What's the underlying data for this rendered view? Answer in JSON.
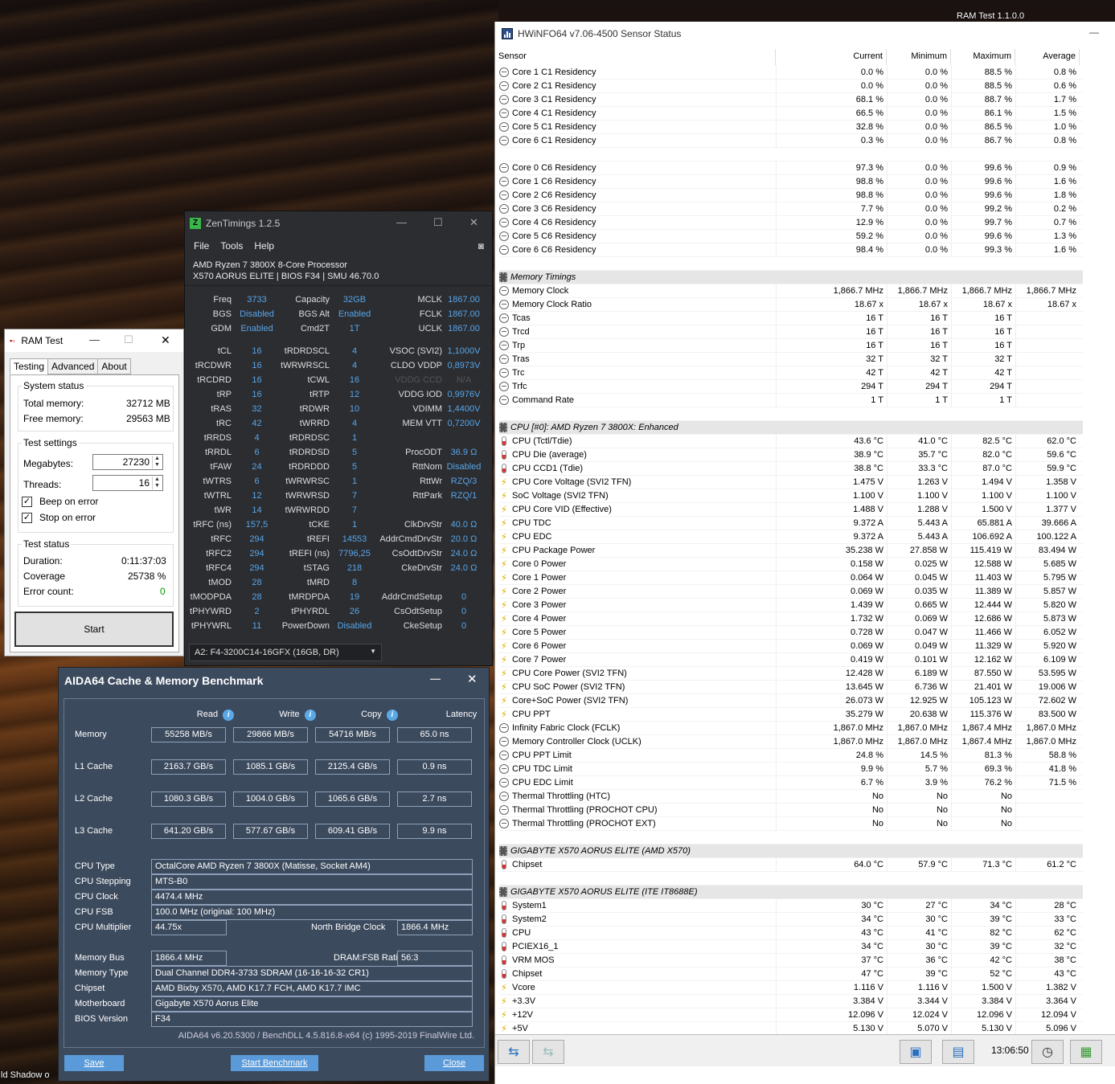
{
  "desktop": {
    "corner_label": "RAM Test 1.1.0.0",
    "bottom_text": "ld  Shadow o"
  },
  "hwinfo": {
    "title": "HWiNFO64 v7.06-4500 Sensor Status",
    "columns": [
      "Sensor",
      "Current",
      "Minimum",
      "Maximum",
      "Average"
    ],
    "time": "13:06:50",
    "rows": [
      {
        "t": "row",
        "i": "clk",
        "n": "Core 1 C1 Residency",
        "c": "0.0 %",
        "mn": "0.0 %",
        "mx": "88.5 %",
        "a": "0.8 %"
      },
      {
        "t": "row",
        "i": "clk",
        "n": "Core 2 C1 Residency",
        "c": "0.0 %",
        "mn": "0.0 %",
        "mx": "88.5 %",
        "a": "0.6 %"
      },
      {
        "t": "row",
        "i": "clk",
        "n": "Core 3 C1 Residency",
        "c": "68.1 %",
        "mn": "0.0 %",
        "mx": "88.7 %",
        "a": "1.7 %"
      },
      {
        "t": "row",
        "i": "clk",
        "n": "Core 4 C1 Residency",
        "c": "66.5 %",
        "mn": "0.0 %",
        "mx": "86.1 %",
        "a": "1.5 %"
      },
      {
        "t": "row",
        "i": "clk",
        "n": "Core 5 C1 Residency",
        "c": "32.8 %",
        "mn": "0.0 %",
        "mx": "86.5 %",
        "a": "1.0 %"
      },
      {
        "t": "row",
        "i": "clk",
        "n": "Core 6 C1 Residency",
        "c": "0.3 %",
        "mn": "0.0 %",
        "mx": "86.7 %",
        "a": "0.8 %"
      },
      {
        "t": "blank"
      },
      {
        "t": "row",
        "i": "clk",
        "n": "Core 0 C6 Residency",
        "c": "97.3 %",
        "mn": "0.0 %",
        "mx": "99.6 %",
        "a": "0.9 %"
      },
      {
        "t": "row",
        "i": "clk",
        "n": "Core 1 C6 Residency",
        "c": "98.8 %",
        "mn": "0.0 %",
        "mx": "99.6 %",
        "a": "1.6 %"
      },
      {
        "t": "row",
        "i": "clk",
        "n": "Core 2 C6 Residency",
        "c": "98.8 %",
        "mn": "0.0 %",
        "mx": "99.6 %",
        "a": "1.8 %"
      },
      {
        "t": "row",
        "i": "clk",
        "n": "Core 3 C6 Residency",
        "c": "7.7 %",
        "mn": "0.0 %",
        "mx": "99.2 %",
        "a": "0.2 %"
      },
      {
        "t": "row",
        "i": "clk",
        "n": "Core 4 C6 Residency",
        "c": "12.9 %",
        "mn": "0.0 %",
        "mx": "99.7 %",
        "a": "0.7 %"
      },
      {
        "t": "row",
        "i": "clk",
        "n": "Core 5 C6 Residency",
        "c": "59.2 %",
        "mn": "0.0 %",
        "mx": "99.6 %",
        "a": "1.3 %"
      },
      {
        "t": "row",
        "i": "clk",
        "n": "Core 6 C6 Residency",
        "c": "98.4 %",
        "mn": "0.0 %",
        "mx": "99.3 %",
        "a": "1.6 %"
      },
      {
        "t": "blank"
      },
      {
        "t": "sec",
        "n": "Memory Timings"
      },
      {
        "t": "row",
        "i": "clk",
        "n": "Memory Clock",
        "c": "1,866.7 MHz",
        "mn": "1,866.7 MHz",
        "mx": "1,866.7 MHz",
        "a": "1,866.7 MHz"
      },
      {
        "t": "row",
        "i": "clk",
        "n": "Memory Clock Ratio",
        "c": "18.67 x",
        "mn": "18.67 x",
        "mx": "18.67 x",
        "a": "18.67 x"
      },
      {
        "t": "row",
        "i": "clk",
        "n": "Tcas",
        "c": "16 T",
        "mn": "16 T",
        "mx": "16 T",
        "a": ""
      },
      {
        "t": "row",
        "i": "clk",
        "n": "Trcd",
        "c": "16 T",
        "mn": "16 T",
        "mx": "16 T",
        "a": ""
      },
      {
        "t": "row",
        "i": "clk",
        "n": "Trp",
        "c": "16 T",
        "mn": "16 T",
        "mx": "16 T",
        "a": ""
      },
      {
        "t": "row",
        "i": "clk",
        "n": "Tras",
        "c": "32 T",
        "mn": "32 T",
        "mx": "32 T",
        "a": ""
      },
      {
        "t": "row",
        "i": "clk",
        "n": "Trc",
        "c": "42 T",
        "mn": "42 T",
        "mx": "42 T",
        "a": ""
      },
      {
        "t": "row",
        "i": "clk",
        "n": "Trfc",
        "c": "294 T",
        "mn": "294 T",
        "mx": "294 T",
        "a": ""
      },
      {
        "t": "row",
        "i": "clk",
        "n": "Command Rate",
        "c": "1 T",
        "mn": "1 T",
        "mx": "1 T",
        "a": ""
      },
      {
        "t": "blank"
      },
      {
        "t": "sec",
        "n": "CPU [#0]: AMD Ryzen 7 3800X: Enhanced"
      },
      {
        "t": "row",
        "i": "tmp",
        "n": "CPU (Tctl/Tdie)",
        "c": "43.6 °C",
        "mn": "41.0 °C",
        "mx": "82.5 °C",
        "a": "62.0 °C"
      },
      {
        "t": "row",
        "i": "tmp",
        "n": "CPU Die (average)",
        "c": "38.9 °C",
        "mn": "35.7 °C",
        "mx": "82.0 °C",
        "a": "59.6 °C"
      },
      {
        "t": "row",
        "i": "tmp",
        "n": "CPU CCD1 (Tdie)",
        "c": "38.8 °C",
        "mn": "33.3 °C",
        "mx": "87.0 °C",
        "a": "59.9 °C"
      },
      {
        "t": "row",
        "i": "bolt",
        "n": "CPU Core Voltage (SVI2 TFN)",
        "c": "1.475 V",
        "mn": "1.263 V",
        "mx": "1.494 V",
        "a": "1.358 V"
      },
      {
        "t": "row",
        "i": "bolt",
        "n": "SoC Voltage (SVI2 TFN)",
        "c": "1.100 V",
        "mn": "1.100 V",
        "mx": "1.100 V",
        "a": "1.100 V"
      },
      {
        "t": "row",
        "i": "bolt",
        "n": "CPU Core VID (Effective)",
        "c": "1.488 V",
        "mn": "1.288 V",
        "mx": "1.500 V",
        "a": "1.377 V"
      },
      {
        "t": "row",
        "i": "bolt",
        "n": "CPU TDC",
        "c": "9.372 A",
        "mn": "5.443 A",
        "mx": "65.881 A",
        "a": "39.666 A"
      },
      {
        "t": "row",
        "i": "bolt",
        "n": "CPU EDC",
        "c": "9.372 A",
        "mn": "5.443 A",
        "mx": "106.692 A",
        "a": "100.122 A"
      },
      {
        "t": "row",
        "i": "bolt",
        "n": "CPU Package Power",
        "c": "35.238 W",
        "mn": "27.858 W",
        "mx": "115.419 W",
        "a": "83.494 W"
      },
      {
        "t": "row",
        "i": "bolt",
        "n": "Core 0 Power",
        "c": "0.158 W",
        "mn": "0.025 W",
        "mx": "12.588 W",
        "a": "5.685 W"
      },
      {
        "t": "row",
        "i": "bolt",
        "n": "Core 1 Power",
        "c": "0.064 W",
        "mn": "0.045 W",
        "mx": "11.403 W",
        "a": "5.795 W"
      },
      {
        "t": "row",
        "i": "bolt",
        "n": "Core 2 Power",
        "c": "0.069 W",
        "mn": "0.035 W",
        "mx": "11.389 W",
        "a": "5.857 W"
      },
      {
        "t": "row",
        "i": "bolt",
        "n": "Core 3 Power",
        "c": "1.439 W",
        "mn": "0.665 W",
        "mx": "12.444 W",
        "a": "5.820 W"
      },
      {
        "t": "row",
        "i": "bolt",
        "n": "Core 4 Power",
        "c": "1.732 W",
        "mn": "0.069 W",
        "mx": "12.686 W",
        "a": "5.873 W"
      },
      {
        "t": "row",
        "i": "bolt",
        "n": "Core 5 Power",
        "c": "0.728 W",
        "mn": "0.047 W",
        "mx": "11.466 W",
        "a": "6.052 W"
      },
      {
        "t": "row",
        "i": "bolt",
        "n": "Core 6 Power",
        "c": "0.069 W",
        "mn": "0.049 W",
        "mx": "11.329 W",
        "a": "5.920 W"
      },
      {
        "t": "row",
        "i": "bolt",
        "n": "Core 7 Power",
        "c": "0.419 W",
        "mn": "0.101 W",
        "mx": "12.162 W",
        "a": "6.109 W"
      },
      {
        "t": "row",
        "i": "bolt",
        "n": "CPU Core Power (SVI2 TFN)",
        "c": "12.428 W",
        "mn": "6.189 W",
        "mx": "87.550 W",
        "a": "53.595 W"
      },
      {
        "t": "row",
        "i": "bolt",
        "n": "CPU SoC Power (SVI2 TFN)",
        "c": "13.645 W",
        "mn": "6.736 W",
        "mx": "21.401 W",
        "a": "19.006 W"
      },
      {
        "t": "row",
        "i": "bolt",
        "n": "Core+SoC Power (SVI2 TFN)",
        "c": "26.073 W",
        "mn": "12.925 W",
        "mx": "105.123 W",
        "a": "72.602 W"
      },
      {
        "t": "row",
        "i": "bolt",
        "n": "CPU PPT",
        "c": "35.279 W",
        "mn": "20.638 W",
        "mx": "115.376 W",
        "a": "83.500 W"
      },
      {
        "t": "row",
        "i": "clk",
        "n": "Infinity Fabric Clock (FCLK)",
        "c": "1,867.0 MHz",
        "mn": "1,867.0 MHz",
        "mx": "1,867.4 MHz",
        "a": "1,867.0 MHz"
      },
      {
        "t": "row",
        "i": "clk",
        "n": "Memory Controller Clock (UCLK)",
        "c": "1,867.0 MHz",
        "mn": "1,867.0 MHz",
        "mx": "1,867.4 MHz",
        "a": "1,867.0 MHz"
      },
      {
        "t": "row",
        "i": "clk",
        "n": "CPU PPT Limit",
        "c": "24.8 %",
        "mn": "14.5 %",
        "mx": "81.3 %",
        "a": "58.8 %"
      },
      {
        "t": "row",
        "i": "clk",
        "n": "CPU TDC Limit",
        "c": "9.9 %",
        "mn": "5.7 %",
        "mx": "69.3 %",
        "a": "41.8 %"
      },
      {
        "t": "row",
        "i": "clk",
        "n": "CPU EDC Limit",
        "c": "6.7 %",
        "mn": "3.9 %",
        "mx": "76.2 %",
        "a": "71.5 %"
      },
      {
        "t": "row",
        "i": "clk",
        "n": "Thermal Throttling (HTC)",
        "c": "No",
        "mn": "No",
        "mx": "No",
        "a": ""
      },
      {
        "t": "row",
        "i": "clk",
        "n": "Thermal Throttling (PROCHOT CPU)",
        "c": "No",
        "mn": "No",
        "mx": "No",
        "a": ""
      },
      {
        "t": "row",
        "i": "clk",
        "n": "Thermal Throttling (PROCHOT EXT)",
        "c": "No",
        "mn": "No",
        "mx": "No",
        "a": ""
      },
      {
        "t": "blank"
      },
      {
        "t": "sec",
        "n": "GIGABYTE X570 AORUS ELITE (AMD X570)"
      },
      {
        "t": "row",
        "i": "tmp",
        "n": "Chipset",
        "c": "64.0 °C",
        "mn": "57.9 °C",
        "mx": "71.3 °C",
        "a": "61.2 °C"
      },
      {
        "t": "blank"
      },
      {
        "t": "sec",
        "n": "GIGABYTE X570 AORUS ELITE (ITE IT8688E)"
      },
      {
        "t": "row",
        "i": "tmp",
        "n": "System1",
        "c": "30 °C",
        "mn": "27 °C",
        "mx": "34 °C",
        "a": "28 °C"
      },
      {
        "t": "row",
        "i": "tmp",
        "n": "System2",
        "c": "34 °C",
        "mn": "30 °C",
        "mx": "39 °C",
        "a": "33 °C"
      },
      {
        "t": "row",
        "i": "tmp",
        "n": "CPU",
        "c": "43 °C",
        "mn": "41 °C",
        "mx": "82 °C",
        "a": "62 °C"
      },
      {
        "t": "row",
        "i": "tmp",
        "n": "PCIEX16_1",
        "c": "34 °C",
        "mn": "30 °C",
        "mx": "39 °C",
        "a": "32 °C"
      },
      {
        "t": "row",
        "i": "tmp",
        "n": "VRM MOS",
        "c": "37 °C",
        "mn": "36 °C",
        "mx": "42 °C",
        "a": "38 °C"
      },
      {
        "t": "row",
        "i": "tmp",
        "n": "Chipset",
        "c": "47 °C",
        "mn": "39 °C",
        "mx": "52 °C",
        "a": "43 °C"
      },
      {
        "t": "row",
        "i": "bolt",
        "n": "Vcore",
        "c": "1.116 V",
        "mn": "1.116 V",
        "mx": "1.500 V",
        "a": "1.382 V"
      },
      {
        "t": "row",
        "i": "bolt",
        "n": "+3.3V",
        "c": "3.384 V",
        "mn": "3.344 V",
        "mx": "3.384 V",
        "a": "3.364 V"
      },
      {
        "t": "row",
        "i": "bolt",
        "n": "+12V",
        "c": "12.096 V",
        "mn": "12.024 V",
        "mx": "12.096 V",
        "a": "12.094 V"
      },
      {
        "t": "row",
        "i": "bolt",
        "n": "+5V",
        "c": "5.130 V",
        "mn": "5.070 V",
        "mx": "5.130 V",
        "a": "5.096 V"
      }
    ]
  },
  "zentimings": {
    "title": "ZenTimings 1.2.5",
    "menu": [
      "File",
      "Tools",
      "Help"
    ],
    "cpu": "AMD Ryzen 7 3800X 8-Core Processor",
    "board": "X570 AORUS ELITE | BIOS F34 | SMU 46.70.0",
    "top": [
      [
        "Freq",
        "3733",
        "Capacity",
        "32GB",
        "MCLK",
        "1867.00"
      ],
      [
        "BGS",
        "Disabled",
        "BGS Alt",
        "Enabled",
        "FCLK",
        "1867.00"
      ],
      [
        "GDM",
        "Enabled",
        "Cmd2T",
        "1T",
        "UCLK",
        "1867.00"
      ]
    ],
    "timings": [
      [
        "tCL",
        "16",
        "tRDRDSCL",
        "4",
        "VSOC (SVI2)",
        "1,1000V"
      ],
      [
        "tRCDWR",
        "16",
        "tWRWRSCL",
        "4",
        "CLDO VDDP",
        "0,8973V"
      ],
      [
        "tRCDRD",
        "16",
        "tCWL",
        "16",
        "VDDG CCD",
        "N/A"
      ],
      [
        "tRP",
        "16",
        "tRTP",
        "12",
        "VDDG IOD",
        "0,9976V"
      ],
      [
        "tRAS",
        "32",
        "tRDWR",
        "10",
        "VDIMM",
        "1,4400V"
      ],
      [
        "tRC",
        "42",
        "tWRRD",
        "4",
        "MEM VTT",
        "0,7200V"
      ],
      [
        "tRRDS",
        "4",
        "tRDRDSC",
        "1",
        "",
        ""
      ],
      [
        "tRRDL",
        "6",
        "tRDRDSD",
        "5",
        "ProcODT",
        "36.9 Ω"
      ],
      [
        "tFAW",
        "24",
        "tRDRDDD",
        "5",
        "RttNom",
        "Disabled"
      ],
      [
        "tWTRS",
        "6",
        "tWRWRSC",
        "1",
        "RttWr",
        "RZQ/3"
      ],
      [
        "tWTRL",
        "12",
        "tWRWRSD",
        "7",
        "RttPark",
        "RZQ/1"
      ],
      [
        "tWR",
        "14",
        "tWRWRDD",
        "7",
        "",
        ""
      ],
      [
        "tRFC (ns)",
        "157,5",
        "tCKE",
        "1",
        "ClkDrvStr",
        "40.0 Ω"
      ],
      [
        "tRFC",
        "294",
        "tREFI",
        "14553",
        "AddrCmdDrvStr",
        "20.0 Ω"
      ],
      [
        "tRFC2",
        "294",
        "tREFI (ns)",
        "7796,25",
        "CsOdtDrvStr",
        "24.0 Ω"
      ],
      [
        "tRFC4",
        "294",
        "tSTAG",
        "218",
        "CkeDrvStr",
        "24.0 Ω"
      ],
      [
        "tMOD",
        "28",
        "tMRD",
        "8",
        "",
        ""
      ],
      [
        "tMODPDA",
        "28",
        "tMRDPDA",
        "19",
        "AddrCmdSetup",
        "0"
      ],
      [
        "tPHYWRD",
        "2",
        "tPHYRDL",
        "26",
        "CsOdtSetup",
        "0"
      ],
      [
        "tPHYWRL",
        "11",
        "PowerDown",
        "Disabled",
        "CkeSetup",
        "0"
      ]
    ],
    "module": "A2: F4-3200C14-16GFX (16GB, DR)"
  },
  "ramtest": {
    "title": "RAM Test",
    "tabs": [
      "Testing",
      "Advanced",
      "About"
    ],
    "system_status": "System status",
    "total_label": "Total memory:",
    "total": "32712 MB",
    "free_label": "Free memory:",
    "free": "29563 MB",
    "settings": "Test settings",
    "mb_label": "Megabytes:",
    "mb": "27230",
    "threads_label": "Threads:",
    "threads": "16",
    "beep": "Beep on error",
    "stop": "Stop on error",
    "test_status": "Test status",
    "duration_label": "Duration:",
    "duration": "0:11:37:03",
    "coverage_label": "Coverage",
    "coverage": "25738 %",
    "errors_label": "Error count:",
    "errors": "0",
    "start": "Start"
  },
  "aida": {
    "title": "AIDA64 Cache & Memory Benchmark",
    "cols": [
      "Read",
      "Write",
      "Copy",
      "Latency"
    ],
    "bench": [
      [
        "Memory",
        "55258 MB/s",
        "29866 MB/s",
        "54716 MB/s",
        "65.0 ns"
      ],
      [
        "L1 Cache",
        "2163.7 GB/s",
        "1085.1 GB/s",
        "2125.4 GB/s",
        "0.9 ns"
      ],
      [
        "L2 Cache",
        "1080.3 GB/s",
        "1004.0 GB/s",
        "1065.6 GB/s",
        "2.7 ns"
      ],
      [
        "L3 Cache",
        "641.20 GB/s",
        "577.67 GB/s",
        "609.41 GB/s",
        "9.9 ns"
      ]
    ],
    "cpu_type_l": "CPU Type",
    "cpu_type": "OctalCore AMD Ryzen 7 3800X  (Matisse, Socket AM4)",
    "cpu_step_l": "CPU Stepping",
    "cpu_step": "MTS-B0",
    "cpu_clock_l": "CPU Clock",
    "cpu_clock": "4474.4 MHz",
    "cpu_fsb_l": "CPU FSB",
    "cpu_fsb": "100.0 MHz  (original: 100 MHz)",
    "cpu_mult_l": "CPU Multiplier",
    "cpu_mult": "44.75x",
    "nb_l": "North Bridge Clock",
    "nb": "1866.4 MHz",
    "mem_bus_l": "Memory Bus",
    "mem_bus": "1866.4 MHz",
    "ratio_l": "DRAM:FSB Ratio",
    "ratio": "56:3",
    "mem_type_l": "Memory Type",
    "mem_type": "Dual Channel DDR4-3733 SDRAM  (16-16-16-32 CR1)",
    "chipset_l": "Chipset",
    "chipset": "AMD Bixby X570, AMD K17.7 FCH, AMD K17.7 IMC",
    "mobo_l": "Motherboard",
    "mobo": "Gigabyte X570 Aorus Elite",
    "bios_l": "BIOS Version",
    "bios": "F34",
    "footer": "AIDA64 v6.20.5300 / BenchDLL 4.5.816.8-x64  (c) 1995-2019 FinalWire Ltd.",
    "save": "Save",
    "start": "Start Benchmark",
    "close": "Close"
  }
}
